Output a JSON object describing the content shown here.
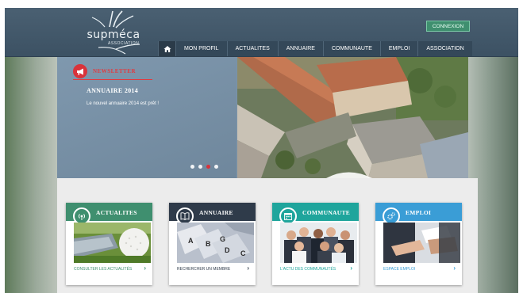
{
  "brand": {
    "name": "supméca",
    "subtitle": "ASSOCIATION"
  },
  "header": {
    "connexion_label": "CONNEXION"
  },
  "nav": {
    "items": [
      "MON PROFIL",
      "ACTUALITES",
      "ANNUAIRE",
      "COMMUNAUTE",
      "EMPLOI",
      "ASSOCIATION"
    ],
    "home_icon": "home-icon"
  },
  "hero": {
    "section_label": "NEWSLETTER",
    "title": "ANNUAIRE 2014",
    "text": "Le nouvel annuaire 2014 est prêt !",
    "slides": 4,
    "active_slide": 3
  },
  "cards": [
    {
      "title": "ACTUALITES",
      "link": "CONSULTER LES ACTUALITÉS",
      "color": "#3f8f6f",
      "icon": "broadcast-icon"
    },
    {
      "title": "ANNUAIRE",
      "link": "RECHERCHER UN MEMBRE",
      "color": "#2f3b4a",
      "icon": "book-icon"
    },
    {
      "title": "COMMUNAUTE",
      "link": "L'ACTU DES COMMUNAUTÉS",
      "color": "#1fa59c",
      "icon": "calendar-icon"
    },
    {
      "title": "EMPLOI",
      "link": "ESPACE EMPLOI",
      "color": "#3a9dd6",
      "icon": "gears-icon"
    }
  ],
  "colors": {
    "accent_red": "#d9323a",
    "header_bg": "#3c5163"
  }
}
